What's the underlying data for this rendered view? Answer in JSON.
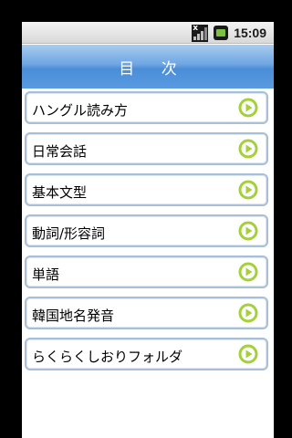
{
  "status_bar": {
    "time": "15:09",
    "icons": [
      "signal-icon",
      "battery-icon"
    ]
  },
  "header": {
    "title": "目 次"
  },
  "menu": {
    "items": [
      {
        "label": "ハングル読み方"
      },
      {
        "label": "日常会話"
      },
      {
        "label": "基本文型"
      },
      {
        "label": "動詞/形容詞"
      },
      {
        "label": "単語"
      },
      {
        "label": "韓国地名発音"
      },
      {
        "label": "らくらくしおりフォルダ"
      }
    ],
    "item_icon": "play-circle-icon"
  },
  "colors": {
    "header_blue": "#5a9ae0",
    "item_border": "#a9bfd8",
    "play_icon_green": "#9acd32"
  }
}
